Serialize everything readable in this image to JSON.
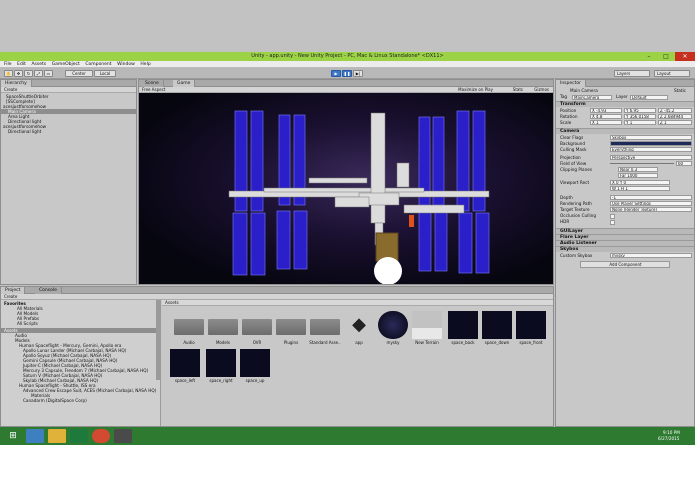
{
  "window": {
    "title": "Unity - app.unity - New Unity Project - PC, Mac & Linux Standalone* <DX11>"
  },
  "menu": [
    "File",
    "Edit",
    "Assets",
    "GameObject",
    "Component",
    "Window",
    "Help"
  ],
  "toolbar": {
    "pivot": "Center",
    "space": "Local",
    "layers": "Layers",
    "layout": "Layout"
  },
  "hierarchy": {
    "tab": "Hierarchy",
    "create": "Create",
    "items": [
      "SpaceShuttleOrbiter",
      "[SSComplete]",
      "acesjustforsomehow",
      "Main Camera",
      "Area Light",
      "Directional light",
      "acesjustforsomehow",
      "Directional light"
    ]
  },
  "scene": {
    "scene_tab": "Scene",
    "game_tab": "Game",
    "aspect": "Free Aspect",
    "opts": [
      "Maximize on Play",
      "Stats",
      "Gizmos"
    ]
  },
  "inspector": {
    "tab": "Inspector",
    "object": "Main Camera",
    "static": "Static",
    "tag_label": "Tag",
    "tag": "MainCamera",
    "layer_label": "Layer",
    "layer": "Default",
    "transform": "Transform",
    "position": {
      "label": "Position",
      "x": "X -4.93",
      "y": "Y 6.95",
      "z": "Z -45.2"
    },
    "rotation": {
      "label": "Rotation",
      "x": "X 4.8",
      "y": "Y 356.0158",
      "z": "Z 2.684944"
    },
    "scale": {
      "label": "Scale",
      "x": "X 1",
      "y": "Y 1",
      "z": "Z 1"
    },
    "camera": "Camera",
    "rows": [
      {
        "k": "Clear Flags",
        "v": "Skybox"
      },
      {
        "k": "Background",
        "v": ""
      },
      {
        "k": "Culling Mask",
        "v": "Everything"
      },
      {
        "k": "Projection",
        "v": "Perspective"
      },
      {
        "k": "Field of View",
        "v": "60"
      },
      {
        "k": "Clipping Planes",
        "v": "Near 0.3"
      },
      {
        "k": "",
        "v": "Far 1000"
      },
      {
        "k": "Viewport Rect",
        "v": "X 0   Y 0"
      },
      {
        "k": "",
        "v": "W 1   H 1"
      },
      {
        "k": "Depth",
        "v": "-1"
      },
      {
        "k": "Rendering Path",
        "v": "Use Player Settings"
      },
      {
        "k": "Target Texture",
        "v": "None (Render Texture)"
      },
      {
        "k": "Occlusion Culling",
        "v": ""
      },
      {
        "k": "HDR",
        "v": ""
      }
    ],
    "components": [
      "GUILayer",
      "Flare Layer",
      "Audio Listener",
      "Skybox"
    ],
    "custom_skybox_label": "Custom Skybox",
    "custom_skybox": "mysky",
    "add_component": "Add Component"
  },
  "project": {
    "tab": "Project",
    "console_tab": "Console",
    "create": "Create",
    "favorites": "Favorites",
    "fav_items": [
      "All Materials",
      "All Models",
      "All Prefabs",
      "All Scripts"
    ],
    "assets_root": "Assets",
    "tree": [
      "Audio",
      "Models",
      "Human Spaceflight - Mercury, Gemini, Apollo era",
      "Apollo Lunar Lander (Michael Carbajal, NASA HQ)",
      "Apollo Soyuz (Michael Carbajal, NASA HQ)",
      "Gemini Capsule (Michael Carbajal, NASA HQ)",
      "Jupiter-C (Michael Carbajal, NASA HQ)",
      "Mercury 3 Capsule, Freedom 7 (Michael Carbajal, NASA HQ)",
      "Saturn V (Michael Carbajal, NASA HQ)",
      "Skylab (Michael Carbajal, NASA HQ)",
      "Human Spaceflight - Shuttle, ISS era",
      "Advanced Crew Escape Suit, ACES (Michael Carbajal, NASA HQ)",
      "Materials",
      "Canadarm (DigitalSpace Corp)"
    ],
    "breadcrumb": "Assets",
    "assets": [
      "Audio",
      "Models",
      "OVR",
      "Plugins",
      "Standard Asse..",
      "app",
      "mysky",
      "New Terrain",
      "space_back",
      "space_down",
      "space_front",
      "space_left",
      "space_right",
      "space_up"
    ]
  },
  "taskbar": {
    "time": "9:10 PM",
    "date": "6/27/2015"
  }
}
